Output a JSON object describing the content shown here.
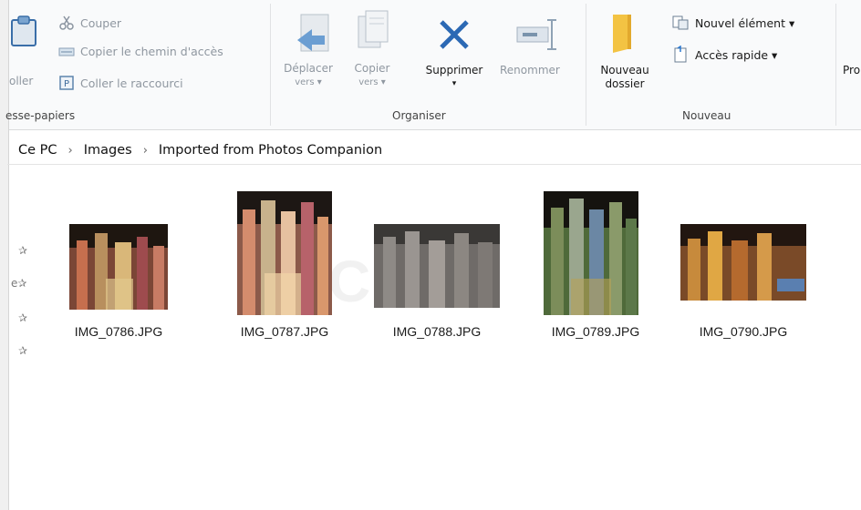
{
  "ribbon": {
    "clipboard": {
      "paste_partial": "oller",
      "cut": "Couper",
      "copy_path": "Copier le chemin d'accès",
      "paste_shortcut": "Coller le raccourci",
      "group_label": "esse-papiers"
    },
    "organize": {
      "move_to_line1": "Déplacer",
      "move_to_line2": "vers ▾",
      "copy_to_line1": "Copier",
      "copy_to_line2": "vers ▾",
      "delete": "Supprimer",
      "delete_arrow": "▾",
      "rename": "Renommer",
      "group_label": "Organiser"
    },
    "new": {
      "new_folder_line1": "Nouveau",
      "new_folder_line2": "dossier",
      "new_item": "Nouvel élément ▾",
      "quick_access": "Accès rapide ▾",
      "group_label": "Nouveau"
    },
    "properties_partial": "Pro"
  },
  "address": {
    "crumbs": [
      "Ce PC",
      "Images",
      "Imported from Photos Companion"
    ],
    "separator": "›"
  },
  "files": [
    {
      "name": "IMG_0786.JPG",
      "icon": "image-thumbnail-icon"
    },
    {
      "name": "IMG_0787.JPG",
      "icon": "image-thumbnail-icon"
    },
    {
      "name": "IMG_0788.JPG",
      "icon": "image-thumbnail-icon"
    },
    {
      "name": "IMG_0789.JPG",
      "icon": "image-thumbnail-icon"
    },
    {
      "name": "IMG_0790.JPG",
      "icon": "image-thumbnail-icon"
    }
  ],
  "watermark": "CA",
  "colors": {
    "ribbon_bg": "#f9fafb",
    "disabled_text": "#8f97a0",
    "accent_blue": "#2b78d0",
    "folder_yellow": "#f3c343"
  }
}
